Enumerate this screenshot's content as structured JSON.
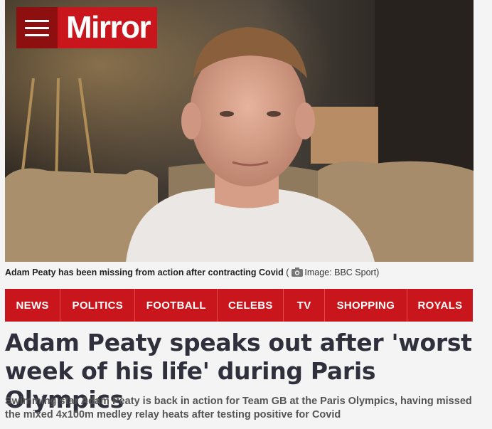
{
  "brand": {
    "name": "Mirror",
    "color": "#c8161c",
    "menu_icon": "hamburger-icon"
  },
  "hero": {
    "caption_text": "Adam Peaty has been missing from action after contracting Covid",
    "credit_icon": "camera-icon",
    "credit_text": "Image: BBC Sport)"
  },
  "nav": {
    "items": [
      {
        "label": "NEWS"
      },
      {
        "label": "POLITICS"
      },
      {
        "label": "FOOTBALL"
      },
      {
        "label": "CELEBS"
      },
      {
        "label": "TV"
      },
      {
        "label": "SHOPPING"
      },
      {
        "label": "ROYALS"
      }
    ]
  },
  "article": {
    "headline": "Adam Peaty speaks out after 'worst week of his life' during Paris Olympics",
    "standfirst": "Swimming star Adam Peaty is back in action for Team GB at the Paris Olympics, having missed the mixed 4x100m medley relay heats after testing positive for Covid"
  }
}
